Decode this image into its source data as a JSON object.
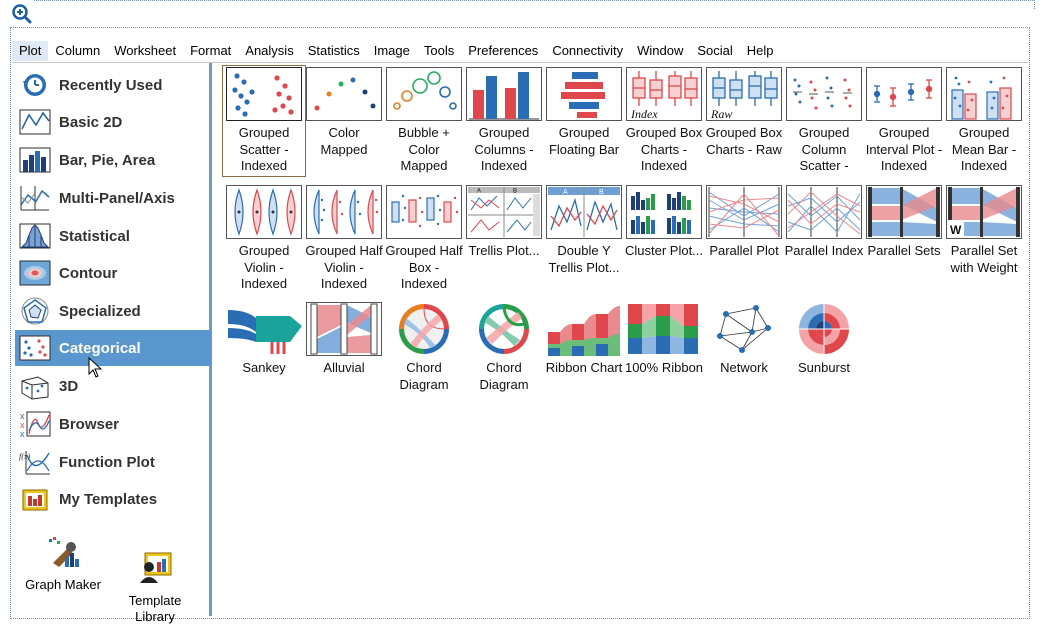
{
  "menubar": {
    "items": [
      "Plot",
      "Column",
      "Worksheet",
      "Format",
      "Analysis",
      "Statistics",
      "Image",
      "Tools",
      "Preferences",
      "Connectivity",
      "Window",
      "Social",
      "Help"
    ]
  },
  "sidebar": {
    "items": [
      {
        "label": "Recently Used",
        "icon": "recently-used-icon"
      },
      {
        "label": "Basic 2D",
        "icon": "basic-2d-icon"
      },
      {
        "label": "Bar, Pie, Area",
        "icon": "bar-chart-icon"
      },
      {
        "label": "Multi-Panel/Axis",
        "icon": "multi-panel-icon"
      },
      {
        "label": "Statistical",
        "icon": "histogram-icon"
      },
      {
        "label": "Contour",
        "icon": "contour-icon"
      },
      {
        "label": "Specialized",
        "icon": "pentagon-icon"
      },
      {
        "label": "Categorical",
        "icon": "categorical-icon",
        "selected": true
      },
      {
        "label": "3D",
        "icon": "3d-icon"
      },
      {
        "label": "Browser",
        "icon": "browser-icon"
      },
      {
        "label": "Function Plot",
        "icon": "function-plot-icon"
      },
      {
        "label": "My Templates",
        "icon": "my-templates-icon"
      }
    ],
    "tools": [
      {
        "label": "Graph Maker",
        "icon": "graph-maker-icon"
      },
      {
        "label": "Template\nLibrary",
        "icon": "template-library-icon"
      }
    ]
  },
  "gallery": {
    "rows": [
      [
        {
          "label": "Grouped Scatter - Indexed",
          "icon": "grouped-scatter-icon",
          "selected": true
        },
        {
          "label": "Color Mapped",
          "icon": "color-mapped-icon"
        },
        {
          "label": "Bubble + Color Mapped",
          "icon": "bubble-icon"
        },
        {
          "label": "Grouped Columns - Indexed",
          "icon": "grouped-columns-icon"
        },
        {
          "label": "Grouped Floating Bar",
          "icon": "floating-bar-icon"
        },
        {
          "label": "Grouped Box Charts - Indexed",
          "icon": "box-index-icon"
        },
        {
          "label": "Grouped Box Charts - Raw",
          "icon": "box-raw-icon"
        },
        {
          "label": "Grouped Column Scatter -",
          "icon": "column-scatter-icon"
        },
        {
          "label": "Grouped Interval Plot - Indexed",
          "icon": "interval-plot-icon"
        },
        {
          "label": "Grouped Mean Bar - Indexed",
          "icon": "mean-bar-icon"
        }
      ],
      [
        {
          "label": "Grouped Violin - Indexed",
          "icon": "violin-icon"
        },
        {
          "label": "Grouped Half Violin - Indexed",
          "icon": "half-violin-icon"
        },
        {
          "label": "Grouped Half Box - Indexed",
          "icon": "half-box-icon"
        },
        {
          "label": "Trellis Plot...",
          "icon": "trellis-icon"
        },
        {
          "label": "Double Y Trellis Plot...",
          "icon": "double-y-trellis-icon"
        },
        {
          "label": "Cluster Plot...",
          "icon": "cluster-plot-icon"
        },
        {
          "label": "Parallel Plot",
          "icon": "parallel-plot-icon"
        },
        {
          "label": "Parallel Index",
          "icon": "parallel-index-icon"
        },
        {
          "label": "Parallel Sets",
          "icon": "parallel-sets-icon"
        },
        {
          "label": "Parallel Set with Weight",
          "icon": "parallel-weight-icon"
        }
      ],
      [
        {
          "label": "Sankey",
          "icon": "sankey-icon"
        },
        {
          "label": "Alluvial",
          "icon": "alluvial-icon"
        },
        {
          "label": "Chord Diagram",
          "icon": "chord-icon-1"
        },
        {
          "label": "Chord Diagram",
          "icon": "chord-icon-2"
        },
        {
          "label": "Ribbon Chart",
          "icon": "ribbon-icon"
        },
        {
          "label": "100% Ribbon",
          "icon": "ribbon-100-icon"
        },
        {
          "label": "Network",
          "icon": "network-icon"
        },
        {
          "label": "Sunburst",
          "icon": "sunburst-icon"
        }
      ]
    ],
    "thumb_text": {
      "index": "Index",
      "raw": "Raw",
      "trellis_a": "A",
      "trellis_b": "B",
      "weight": "W"
    }
  }
}
